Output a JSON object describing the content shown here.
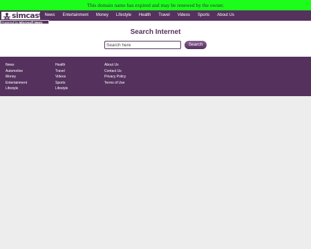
{
  "banner": {
    "text": "This domain name has expired and may be renewed by the owner."
  },
  "header": {
    "logo_text": "simcast",
    "powered_prefix": "Powered by",
    "powered_brand": "Microsoft News",
    "nav": [
      "News",
      "Entertainment",
      "Money",
      "Lifestyle",
      "Health",
      "Travel",
      "Videos",
      "Sports",
      "About Us"
    ]
  },
  "main": {
    "title": "Search Internet",
    "search_placeholder": "Search here",
    "search_button": "Search"
  },
  "footer": {
    "col1": [
      "News",
      "Automotive",
      "Money",
      "Entertainment",
      "Lifestyle"
    ],
    "col2": [
      "Health",
      "Travel",
      "Videos",
      "Sports",
      "Lifestyle"
    ],
    "col3": [
      "About Us",
      "Contact Us",
      "Privacy Policy",
      "Terms of Use"
    ]
  },
  "colors": {
    "banner": "#1cfd1c",
    "brand": "#55315e",
    "page_bg": "#ededed"
  }
}
